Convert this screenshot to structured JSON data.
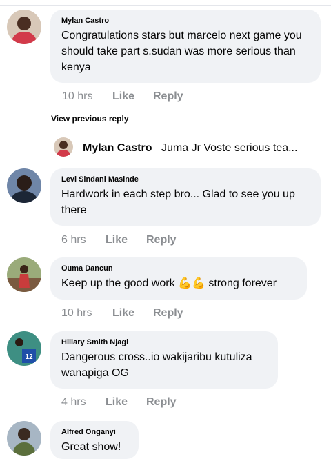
{
  "comments": [
    {
      "author": "Mylan Castro",
      "text": "Congratulations stars but marcelo next game you should take part s.sudan was more serious than kenya",
      "time": "10 hrs",
      "like": "Like",
      "reply": "Reply"
    },
    {
      "author": "Levi Sindani Masinde",
      "text": "Hardwork in each step bro... Glad to see you up there",
      "time": "6 hrs",
      "like": "Like",
      "reply": "Reply"
    },
    {
      "author": "Ouma Dancun",
      "text": "Keep up the good work",
      "text_after": "strong forever",
      "emoji": "💪💪",
      "time": "10 hrs",
      "like": "Like",
      "reply": "Reply"
    },
    {
      "author": "Hillary Smith Njagi",
      "text": "Dangerous cross..io wakijaribu kutuliza wanapiga OG",
      "time": "4 hrs",
      "like": "Like",
      "reply": "Reply"
    },
    {
      "author": "Alfred Onganyi",
      "text": "Great show!"
    }
  ],
  "view_previous": "View previous reply",
  "reply_preview": {
    "author": "Mylan Castro",
    "text": "Juma Jr Voste  serious tea..."
  }
}
